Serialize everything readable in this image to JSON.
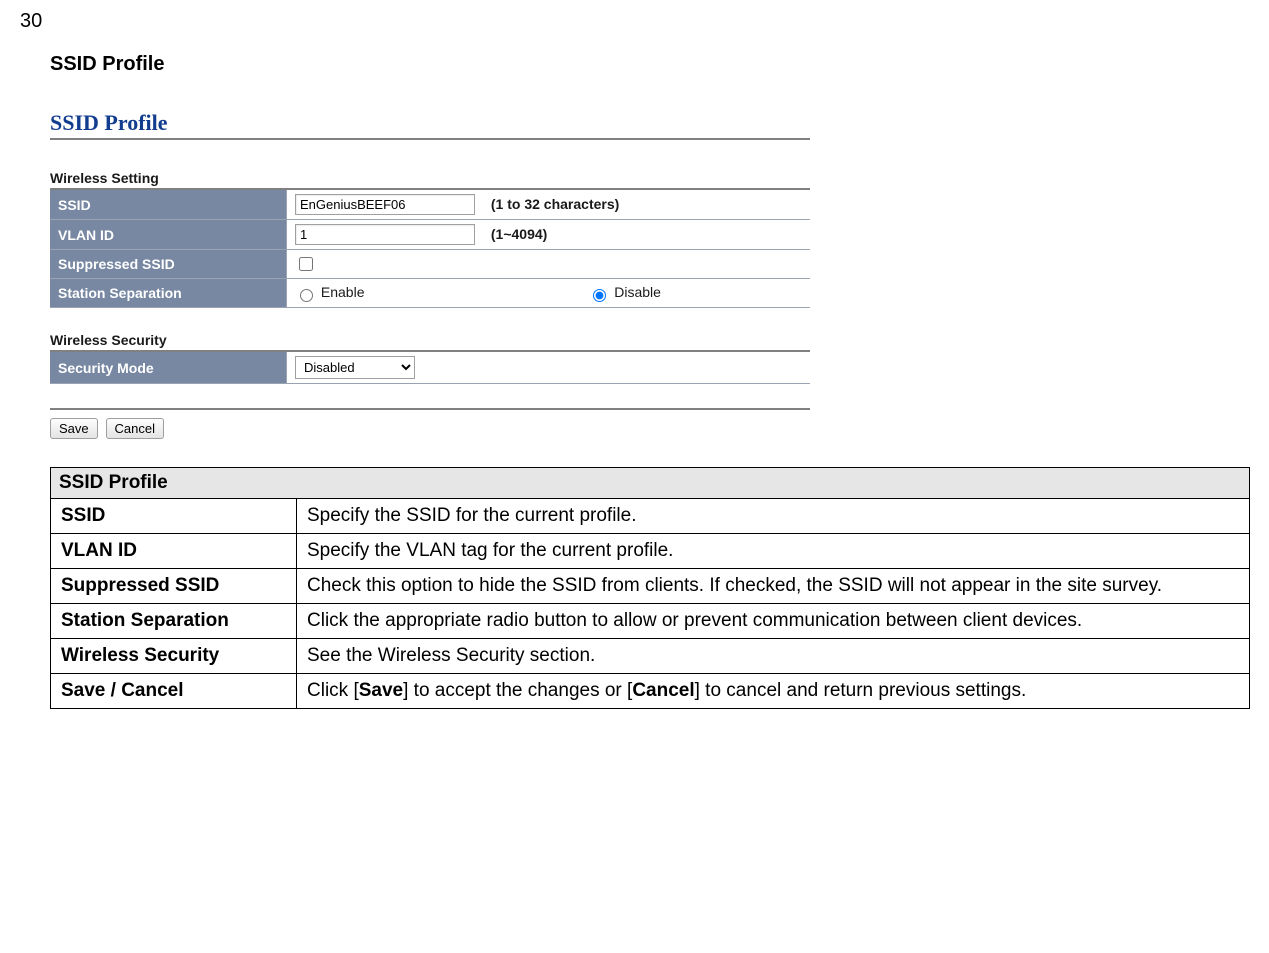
{
  "page_number": "30",
  "heading": "SSID Profile",
  "screenshot": {
    "title": "SSID Profile",
    "wireless_setting": {
      "group_label": "Wireless Setting",
      "ssid": {
        "label": "SSID",
        "value": "EnGeniusBEEF06",
        "hint": "(1 to 32 characters)"
      },
      "vlan_id": {
        "label": "VLAN ID",
        "value": "1",
        "hint": "(1~4094)"
      },
      "suppressed_ssid": {
        "label": "Suppressed SSID",
        "checked": false
      },
      "station_separation": {
        "label": "Station Separation",
        "options": {
          "enable": "Enable",
          "disable": "Disable"
        },
        "selected": "disable"
      }
    },
    "wireless_security": {
      "group_label": "Wireless Security",
      "security_mode": {
        "label": "Security Mode",
        "value": "Disabled"
      }
    },
    "buttons": {
      "save": "Save",
      "cancel": "Cancel"
    }
  },
  "desc_table": {
    "header": "SSID Profile",
    "rows": [
      {
        "term": "SSID",
        "desc": "Specify the SSID for the current profile."
      },
      {
        "term": "VLAN ID",
        "desc": "Specify the VLAN tag for the current profile."
      },
      {
        "term": "Suppressed SSID",
        "desc": "Check this option to hide the SSID from clients. If checked, the SSID will not appear in the site survey."
      },
      {
        "term": "Station Separation",
        "desc": "Click the appropriate radio button to allow or prevent communication between client devices."
      },
      {
        "term": "Wireless Security",
        "desc": "See the Wireless Security section."
      }
    ],
    "save_cancel": {
      "term": "Save / Cancel",
      "desc_prefix": "Click [",
      "desc_save": "Save",
      "desc_mid": "] to accept the changes or [",
      "desc_cancel": "Cancel",
      "desc_suffix": "] to cancel and return previous settings."
    }
  }
}
